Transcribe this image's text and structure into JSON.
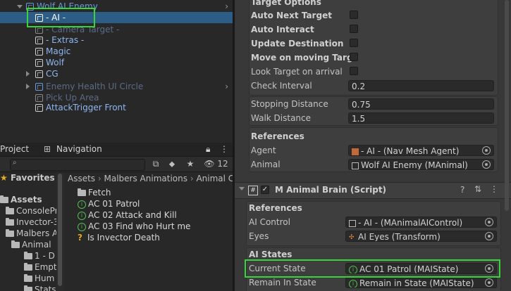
{
  "hierarchy": {
    "items": [
      {
        "label": "Wolf AI Enemy",
        "color": "#6a9ad8"
      },
      {
        "label": "- AI -",
        "color": "#ffffff"
      },
      {
        "label": "- Camera Target -",
        "color": "#5a6b86"
      },
      {
        "label": "- Extras -",
        "color": "#8eb6f0"
      },
      {
        "label": "Magic",
        "color": "#8eb6f0"
      },
      {
        "label": "Wolf",
        "color": "#8eb6f0"
      },
      {
        "label": "CG",
        "color": "#8eb6f0"
      },
      {
        "label": "Enemy Health UI Circle",
        "color": "#5a6b86"
      },
      {
        "label": "Pick Up Area",
        "color": "#5a6b86"
      },
      {
        "label": "AttackTrigger Front",
        "color": "#8eb6f0"
      }
    ]
  },
  "project": {
    "tabs": [
      "Project",
      "Navigation"
    ],
    "hidden_count": "12",
    "tree": [
      {
        "label": "Favorites",
        "icon": "star"
      },
      {
        "label": "Assets",
        "icon": "folder"
      },
      {
        "label": "ConsolePr",
        "icon": "folder"
      },
      {
        "label": "Invector-3",
        "icon": "folder"
      },
      {
        "label": "Malbers A",
        "icon": "folder"
      },
      {
        "label": "Animal",
        "icon": "folder"
      },
      {
        "label": "1 - D",
        "icon": "folder"
      },
      {
        "label": "Empt",
        "icon": "folder"
      },
      {
        "label": "Hum",
        "icon": "folder"
      },
      {
        "label": "Stats",
        "icon": "folder"
      }
    ],
    "breadcrumbs": [
      "Assets",
      "Malbers Animations",
      "Animal C"
    ],
    "files": [
      {
        "label": "Fetch",
        "icon": "folder"
      },
      {
        "label": "AC 01 Patrol",
        "icon": "green"
      },
      {
        "label": "AC 02 Attack and Kill",
        "icon": "green"
      },
      {
        "label": "AC 03 Find who Hurt me",
        "icon": "green"
      },
      {
        "label": "Is Invector Death",
        "icon": "question"
      }
    ]
  },
  "inspector": {
    "target_options_title": "Target Options",
    "auto_next_target": "Auto Next Target",
    "auto_interact": "Auto Interact",
    "update_destination": "Update Destination",
    "move_on_moving_target": "Move on moving Targe",
    "look_target_on_arrival": "Look Target on arrival",
    "check_interval_label": "Check Interval",
    "check_interval_value": "0.2",
    "stopping_distance_label": "Stopping Distance",
    "stopping_distance_value": "0.75",
    "walk_distance_label": "Walk Distance",
    "walk_distance_value": "1.5",
    "references_title": "References",
    "agent_label": "Agent",
    "agent_value": "- AI - (Nav Mesh Agent)",
    "animal_label": "Animal",
    "animal_value": "Wolf AI Enemy (MAnimal)",
    "brain_component_title": "M Animal Brain (Script)",
    "brain_references_title": "References",
    "ai_control_label": "AI Control",
    "ai_control_value": "- AI - (MAnimalAIControl)",
    "eyes_label": "Eyes",
    "eyes_value": "AI Eyes (Transform)",
    "ai_states_title": "AI States",
    "current_state_label": "Current State",
    "current_state_value": "AC 01 Patrol (MAIState)",
    "remain_in_state_label": "Remain In State",
    "remain_in_state_value": "Remain in State (MAIState)"
  },
  "colors": {
    "highlight": "#39d43b",
    "selection": "#2c5d87"
  }
}
